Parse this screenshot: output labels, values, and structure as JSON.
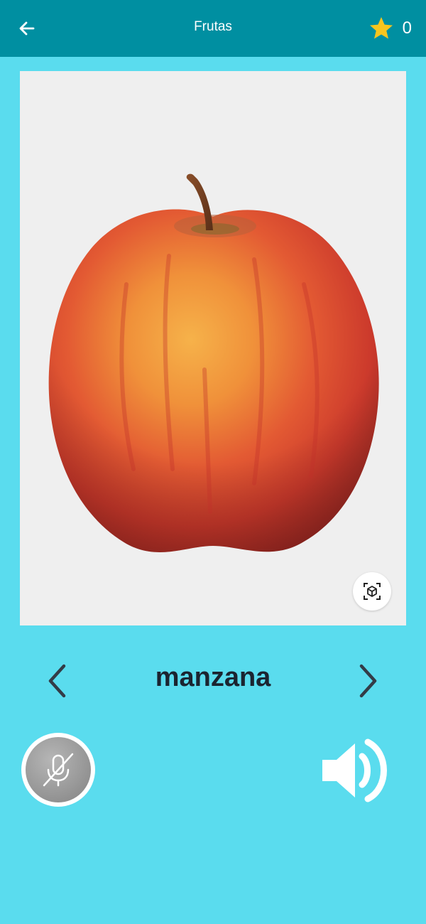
{
  "header": {
    "title": "Frutas",
    "back_icon": "arrow-left-icon",
    "star_icon": "star-icon",
    "score": "0"
  },
  "card": {
    "image_subject": "apple",
    "ar_icon": "ar-cube-icon"
  },
  "word_nav": {
    "word": "manzana",
    "prev_icon": "chevron-left-icon",
    "next_icon": "chevron-right-icon"
  },
  "controls": {
    "mic_icon": "microphone-off-icon",
    "speaker_icon": "speaker-volume-icon"
  },
  "colors": {
    "background": "#5adcee",
    "app_bar": "#008fa1",
    "star": "#f7c51e",
    "word_text": "#1b2430"
  }
}
